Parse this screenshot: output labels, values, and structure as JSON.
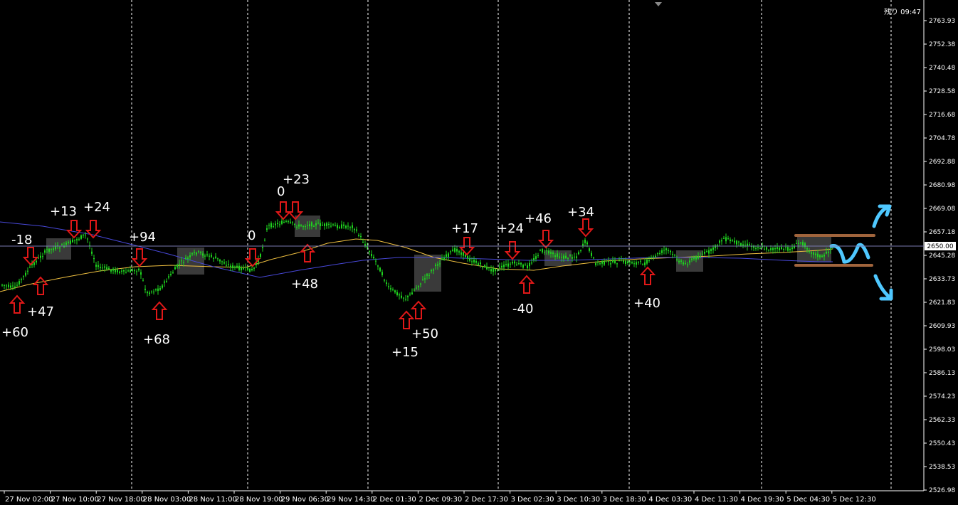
{
  "header": {
    "timer_label": "残り 09:47"
  },
  "price_axis": {
    "ticks": [
      "2763.93",
      "2752.38",
      "2740.48",
      "2728.58",
      "2716.68",
      "2704.78",
      "2692.88",
      "2680.98",
      "2669.08",
      "2657.18",
      "2645.28",
      "2633.73",
      "2621.83",
      "2609.93",
      "2598.03",
      "2586.13",
      "2574.23",
      "2562.33",
      "2550.43",
      "2538.53",
      "2526.98"
    ],
    "current_price": "2650.00"
  },
  "time_axis": {
    "labels": [
      "27 Nov 02:00",
      "27 Nov 10:00",
      "27 Nov 18:00",
      "28 Nov 03:00",
      "28 Nov 11:00",
      "28 Nov 19:00",
      "29 Nov 06:30",
      "29 Nov 14:30",
      "2 Dec 01:30",
      "2 Dec 09:30",
      "2 Dec 17:30",
      "3 Dec 02:30",
      "3 Dec 10:30",
      "3 Dec 18:30",
      "4 Dec 03:30",
      "4 Dec 11:30",
      "4 Dec 19:30",
      "5 Dec 04:30",
      "5 Dec 12:30"
    ]
  },
  "colors": {
    "candle": "#1fd41f",
    "ma_fast": "#f0c040",
    "ma_slow": "#4848d8",
    "arrow": "#e01818",
    "forecast": "#4fc8ff",
    "range": "#a0643c",
    "current_line": "#7a7ab0",
    "session_sep": "#ffffff"
  },
  "annotations": [
    {
      "text": "-18"
    },
    {
      "text": "+47"
    },
    {
      "text": "+60"
    },
    {
      "text": "+13"
    },
    {
      "text": "+24"
    },
    {
      "text": "+94"
    },
    {
      "text": "+68"
    },
    {
      "text": "0"
    },
    {
      "text": "0"
    },
    {
      "text": "+23"
    },
    {
      "text": "+48"
    },
    {
      "text": "+15"
    },
    {
      "text": "+50"
    },
    {
      "text": "+17"
    },
    {
      "text": "+24"
    },
    {
      "text": "-40"
    },
    {
      "text": "+46"
    },
    {
      "text": "+34"
    },
    {
      "text": "+40"
    }
  ],
  "signals": [
    {
      "dir": "up",
      "label": "buy"
    },
    {
      "dir": "down",
      "label": "sell"
    },
    {
      "dir": "up",
      "label": "buy"
    },
    {
      "dir": "down",
      "label": "sell"
    },
    {
      "dir": "down",
      "label": "sell"
    },
    {
      "dir": "down",
      "label": "sell"
    },
    {
      "dir": "up",
      "label": "buy"
    },
    {
      "dir": "down",
      "label": "sell"
    },
    {
      "dir": "down",
      "label": "sell"
    },
    {
      "dir": "down",
      "label": "sell"
    },
    {
      "dir": "up",
      "label": "buy"
    },
    {
      "dir": "up",
      "label": "buy"
    },
    {
      "dir": "up",
      "label": "buy"
    },
    {
      "dir": "down",
      "label": "sell"
    },
    {
      "dir": "down",
      "label": "sell"
    },
    {
      "dir": "up",
      "label": "buy"
    },
    {
      "dir": "down",
      "label": "sell"
    },
    {
      "dir": "down",
      "label": "sell"
    },
    {
      "dir": "up",
      "label": "buy"
    }
  ]
}
